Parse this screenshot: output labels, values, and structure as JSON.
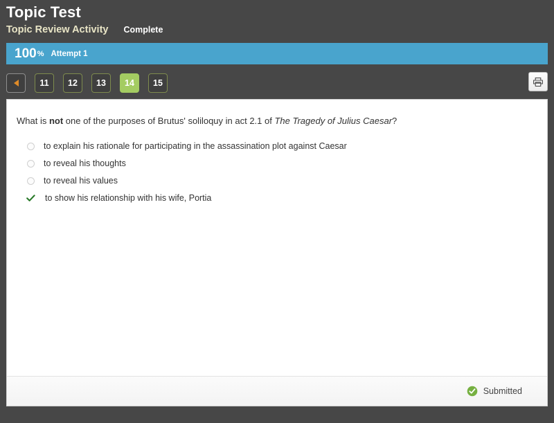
{
  "header": {
    "title": "Topic Test",
    "subtitle": "Topic Review Activity",
    "status": "Complete"
  },
  "score_bar": {
    "score": "100",
    "percent_symbol": "%",
    "attempt": "Attempt 1",
    "color": "#49a4cd"
  },
  "pager": {
    "prev_label": "",
    "pages": [
      {
        "label": "11",
        "current": false
      },
      {
        "label": "12",
        "current": false
      },
      {
        "label": "13",
        "current": false
      },
      {
        "label": "14",
        "current": true
      },
      {
        "label": "15",
        "current": false
      }
    ],
    "current_page": "14",
    "current_color": "#a4cc62",
    "print_tooltip": "Print"
  },
  "question": {
    "prefix": "What is ",
    "emphasis": "not",
    "middle": " one of the purposes of Brutus' soliloquy in act 2.1 of ",
    "title_italic": "The Tragedy of Julius Caesar",
    "suffix": "?"
  },
  "options": [
    {
      "text": "to explain his rationale for participating in the assassination plot against Caesar",
      "marked": false
    },
    {
      "text": "to reveal his thoughts",
      "marked": false
    },
    {
      "text": "to reveal his values",
      "marked": false
    },
    {
      "text": "to show his relationship with his wife, Portia",
      "marked": true
    }
  ],
  "footer": {
    "submitted_label": "Submitted",
    "submitted_color": "#76b041"
  }
}
